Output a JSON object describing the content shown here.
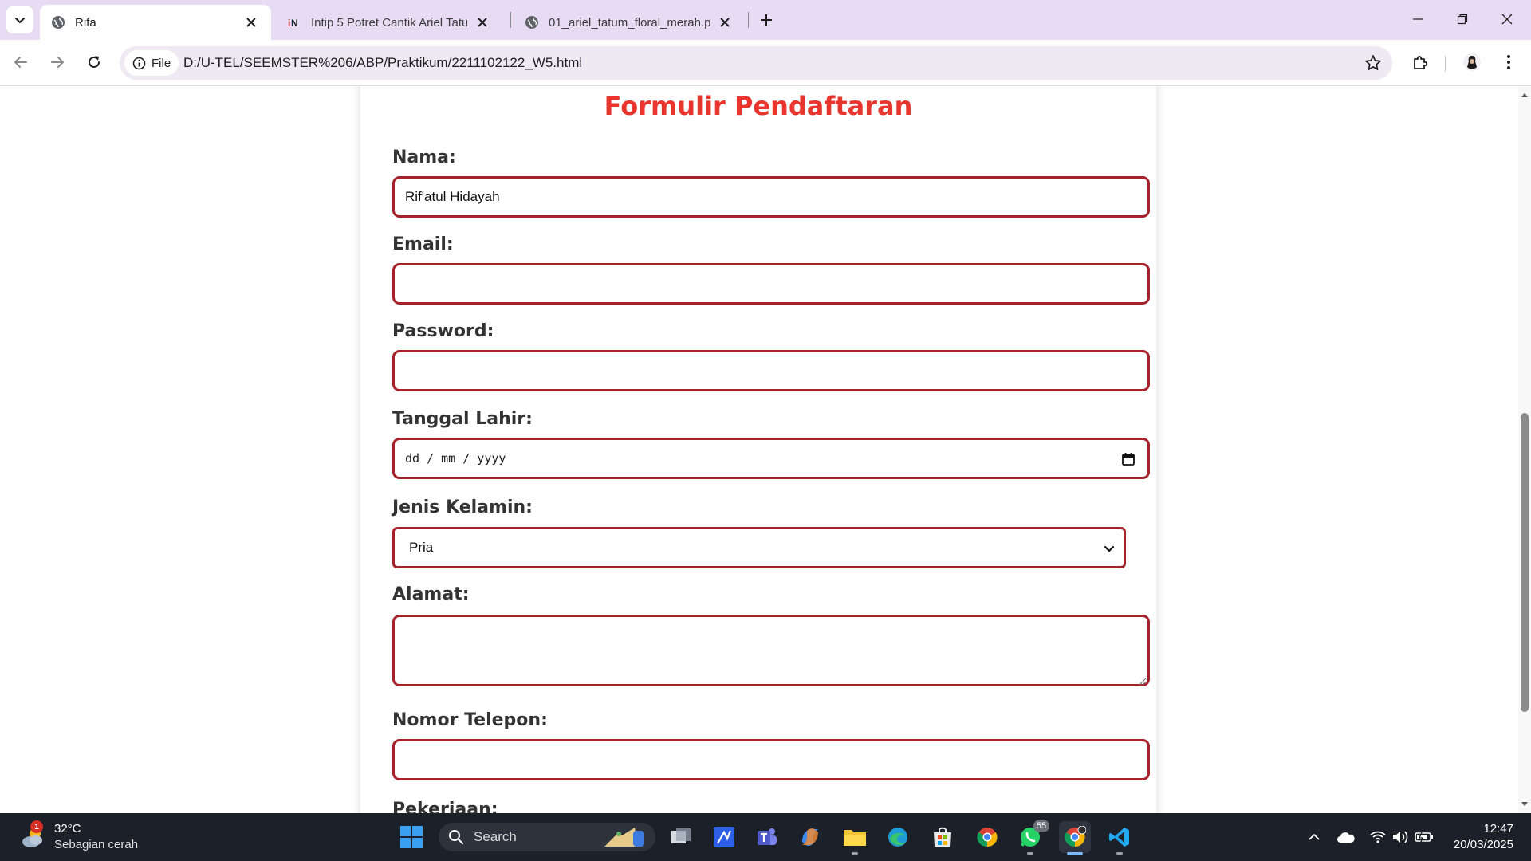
{
  "browser": {
    "tabs": [
      {
        "title": "Rifa",
        "favicon": "globe-icon",
        "active": true
      },
      {
        "title": "Intip 5 Potret Cantik Ariel Tatum",
        "favicon": "idn-icon",
        "active": false
      },
      {
        "title": "01_ariel_tatum_floral_merah.png",
        "favicon": "globe-icon",
        "active": false
      }
    ],
    "site_chip": "File",
    "url": "D:/U-TEL/SEEMSTER%206/ABP/Praktikum/2211102122_W5.html"
  },
  "form": {
    "title": "Formulir Pendaftaran",
    "fields": {
      "nama": {
        "label": "Nama:",
        "value": "Rif'atul Hidayah"
      },
      "email": {
        "label": "Email:",
        "value": ""
      },
      "password": {
        "label": "Password:",
        "value": ""
      },
      "tanggal_lahir": {
        "label": "Tanggal Lahir:",
        "value": "dd / mm / yyyy"
      },
      "jenis_kelamin": {
        "label": "Jenis Kelamin:",
        "value": "Pria"
      },
      "alamat": {
        "label": "Alamat:",
        "value": ""
      },
      "nomor_telepon": {
        "label": "Nomor Telepon:",
        "value": ""
      },
      "pekerjaan": {
        "label": "Pekerjaan:"
      }
    }
  },
  "taskbar": {
    "weather": {
      "temp": "32°C",
      "desc": "Sebagian cerah",
      "badge": "1"
    },
    "search_label": "Search",
    "whatsapp_badge": "55",
    "time": "12:47",
    "date": "20/03/2025"
  },
  "colors": {
    "title": "#e8352e",
    "field_border": "#a5222b",
    "tabstrip": "#e8dcf5",
    "taskbar": "#1c2029"
  }
}
